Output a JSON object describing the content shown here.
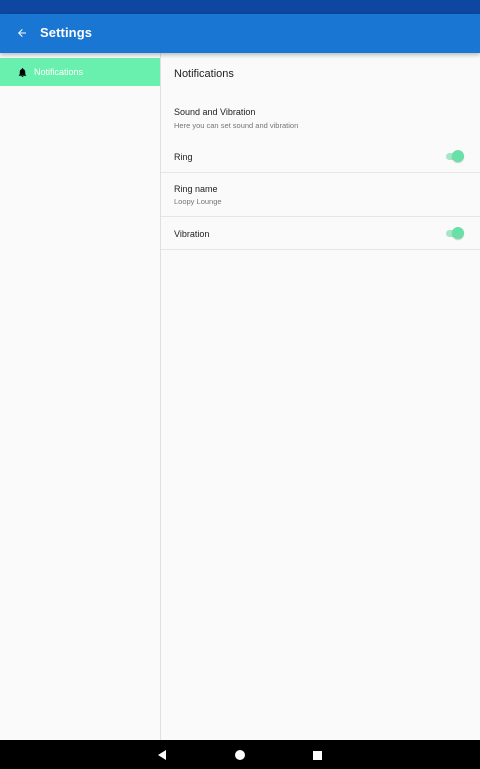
{
  "app_bar": {
    "title": "Settings",
    "back_icon": "arrow-left-icon",
    "color": "#1976d2"
  },
  "status_bar": {
    "color": "#0d47a1"
  },
  "sidebar": {
    "items": [
      {
        "label": "Notifications",
        "icon": "bell-icon",
        "selected": true,
        "color": "#69f0ae"
      }
    ]
  },
  "content": {
    "title": "Notifications",
    "preferences": [
      {
        "title": "Sound and Vibration",
        "summary": "Here you can set sound and vibration",
        "type": "header"
      },
      {
        "title": "Ring",
        "type": "switch",
        "checked": true
      },
      {
        "title": "Ring name",
        "summary": "Loopy Lounge",
        "type": "list"
      },
      {
        "title": "Vibration",
        "type": "switch",
        "checked": true
      }
    ]
  },
  "nav_bar": {
    "buttons": [
      {
        "icon": "back-triangle-icon"
      },
      {
        "icon": "home-circle-icon"
      },
      {
        "icon": "recents-square-icon"
      }
    ]
  }
}
